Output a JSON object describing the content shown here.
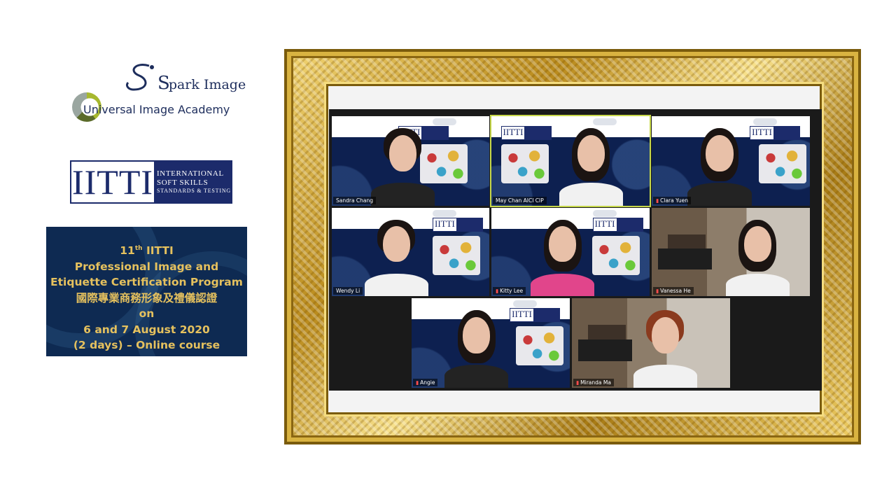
{
  "left_panel": {
    "spark_logo": {
      "brand": "park Image",
      "initial": "S",
      "academy": "Universal Image Academy"
    },
    "iitti_logo": {
      "acronym": "IITTI",
      "line1": "INTERNATIONAL",
      "line2": "SOFT SKILLS",
      "line3": "STANDARDS & TESTING"
    },
    "program": {
      "edition_number": "11",
      "edition_suffix": "th",
      "edition_name": " IITTI",
      "line2": "Professional Image and",
      "line3": "Etiquette Certification Program",
      "line4": "國際專業商務形象及禮儀認證",
      "line5": "on",
      "line6": "6 and 7 August 2020",
      "line7": "(2 days) – Online course"
    }
  },
  "meeting": {
    "slide_badge": "IITTI",
    "participants": [
      {
        "name": "Sandra Chang",
        "muted": false,
        "speaking": false
      },
      {
        "name": "May Chan  AICI CIP",
        "muted": false,
        "speaking": true
      },
      {
        "name": "Clara Yuen",
        "muted": true,
        "speaking": false
      },
      {
        "name": "Wendy Li",
        "muted": false,
        "speaking": false
      },
      {
        "name": "Kitty Lee",
        "muted": true,
        "speaking": false
      },
      {
        "name": "Vanessa He",
        "muted": true,
        "speaking": false
      },
      {
        "name": "Angie",
        "muted": true,
        "speaking": false
      },
      {
        "name": "Miranda Ma",
        "muted": true,
        "speaking": false
      }
    ],
    "colors": {
      "active_outline": "#c7d84a",
      "slide_navy": "#0d2050",
      "frame_gold": "#d9b341"
    }
  }
}
